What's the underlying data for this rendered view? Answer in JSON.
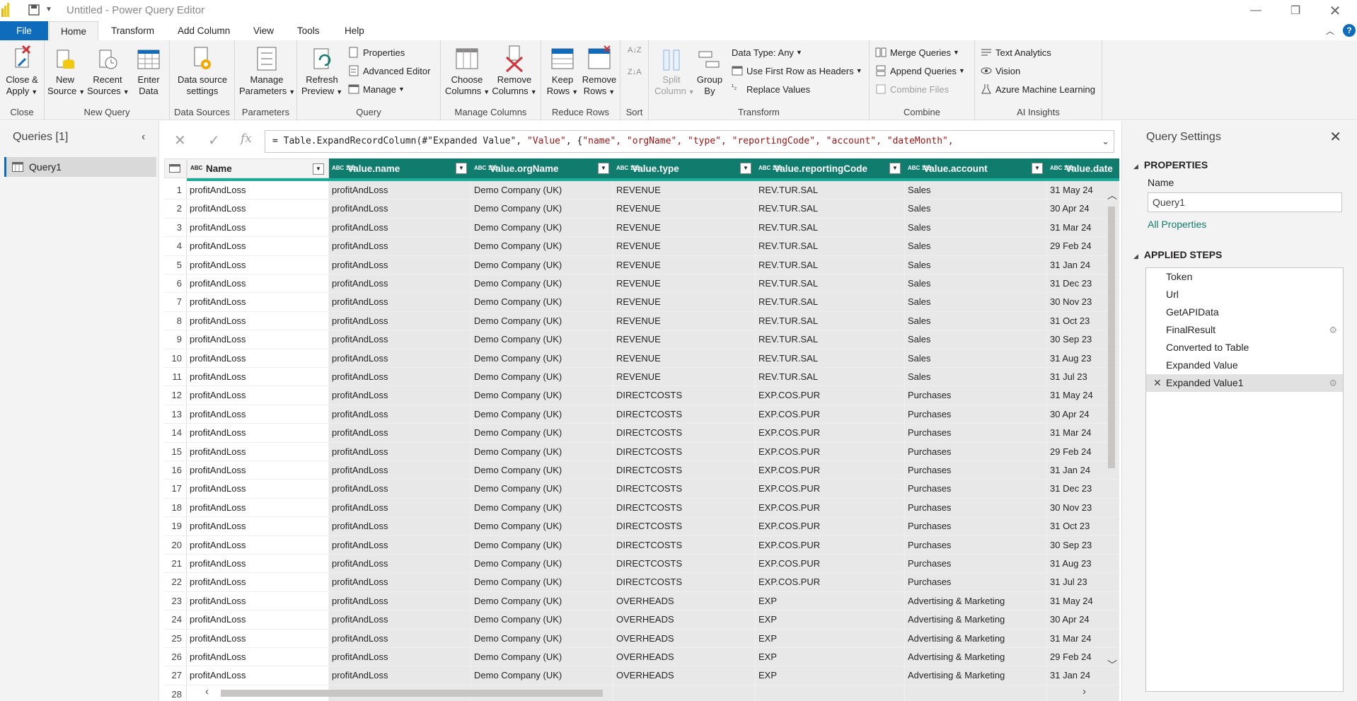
{
  "window": {
    "title": "Untitled - Power Query Editor"
  },
  "tabs": [
    "File",
    "Home",
    "Transform",
    "Add Column",
    "View",
    "Tools",
    "Help"
  ],
  "ribbon": {
    "close": {
      "label1": "Close &",
      "label2": "Apply",
      "group": "Close"
    },
    "new_query": {
      "new_source1": "New",
      "new_source2": "Source",
      "recent1": "Recent",
      "recent2": "Sources",
      "enter1": "Enter",
      "enter2": "Data",
      "group": "New Query"
    },
    "data_sources": {
      "label1": "Data source",
      "label2": "settings",
      "group": "Data Sources"
    },
    "parameters": {
      "label1": "Manage",
      "label2": "Parameters",
      "group": "Parameters"
    },
    "query": {
      "refresh1": "Refresh",
      "refresh2": "Preview",
      "properties": "Properties",
      "advanced": "Advanced Editor",
      "manage": "Manage",
      "group": "Query"
    },
    "manage_columns": {
      "choose1": "Choose",
      "choose2": "Columns",
      "remove1": "Remove",
      "remove2": "Columns",
      "group": "Manage Columns"
    },
    "reduce_rows": {
      "keep1": "Keep",
      "keep2": "Rows",
      "remove1": "Remove",
      "remove2": "Rows",
      "group": "Reduce Rows"
    },
    "sort": {
      "group": "Sort"
    },
    "transform": {
      "split1": "Split",
      "split2": "Column",
      "group1": "Group",
      "group2": "By",
      "datatype": "Data Type: Any",
      "first_row": "Use First Row as Headers",
      "replace": "Replace Values",
      "group": "Transform"
    },
    "combine": {
      "merge": "Merge Queries",
      "append": "Append Queries",
      "files": "Combine Files",
      "group": "Combine"
    },
    "ai": {
      "text": "Text Analytics",
      "vision": "Vision",
      "azure": "Azure Machine Learning",
      "group": "AI Insights"
    }
  },
  "queries_pane": {
    "title": "Queries [1]",
    "items": [
      "Query1"
    ]
  },
  "formula": {
    "prefix": "= Table.ExpandRecordColumn(#\"Expanded Value\", ",
    "value": "\"Value\"",
    "mid": ", {",
    "fields": "\"name\", \"orgName\", \"type\", \"reportingCode\", \"account\", \"dateMonth\","
  },
  "grid": {
    "columns": [
      {
        "label": "Name",
        "type": "ABC"
      },
      {
        "label": "Value.name",
        "type": "ABC/123"
      },
      {
        "label": "Value.orgName",
        "type": "ABC/123"
      },
      {
        "label": "Value.type",
        "type": "ABC/123"
      },
      {
        "label": "Value.reportingCode",
        "type": "ABC/123"
      },
      {
        "label": "Value.account",
        "type": "ABC/123"
      },
      {
        "label": "Value.date",
        "type": "ABC/123"
      }
    ],
    "rows": [
      [
        "1",
        "profitAndLoss",
        "profitAndLoss",
        "Demo Company (UK)",
        "REVENUE",
        "REV.TUR.SAL",
        "Sales",
        "31 May 24"
      ],
      [
        "2",
        "profitAndLoss",
        "profitAndLoss",
        "Demo Company (UK)",
        "REVENUE",
        "REV.TUR.SAL",
        "Sales",
        "30 Apr 24"
      ],
      [
        "3",
        "profitAndLoss",
        "profitAndLoss",
        "Demo Company (UK)",
        "REVENUE",
        "REV.TUR.SAL",
        "Sales",
        "31 Mar 24"
      ],
      [
        "4",
        "profitAndLoss",
        "profitAndLoss",
        "Demo Company (UK)",
        "REVENUE",
        "REV.TUR.SAL",
        "Sales",
        "29 Feb 24"
      ],
      [
        "5",
        "profitAndLoss",
        "profitAndLoss",
        "Demo Company (UK)",
        "REVENUE",
        "REV.TUR.SAL",
        "Sales",
        "31 Jan 24"
      ],
      [
        "6",
        "profitAndLoss",
        "profitAndLoss",
        "Demo Company (UK)",
        "REVENUE",
        "REV.TUR.SAL",
        "Sales",
        "31 Dec 23"
      ],
      [
        "7",
        "profitAndLoss",
        "profitAndLoss",
        "Demo Company (UK)",
        "REVENUE",
        "REV.TUR.SAL",
        "Sales",
        "30 Nov 23"
      ],
      [
        "8",
        "profitAndLoss",
        "profitAndLoss",
        "Demo Company (UK)",
        "REVENUE",
        "REV.TUR.SAL",
        "Sales",
        "31 Oct 23"
      ],
      [
        "9",
        "profitAndLoss",
        "profitAndLoss",
        "Demo Company (UK)",
        "REVENUE",
        "REV.TUR.SAL",
        "Sales",
        "30 Sep 23"
      ],
      [
        "10",
        "profitAndLoss",
        "profitAndLoss",
        "Demo Company (UK)",
        "REVENUE",
        "REV.TUR.SAL",
        "Sales",
        "31 Aug 23"
      ],
      [
        "11",
        "profitAndLoss",
        "profitAndLoss",
        "Demo Company (UK)",
        "REVENUE",
        "REV.TUR.SAL",
        "Sales",
        "31 Jul 23"
      ],
      [
        "12",
        "profitAndLoss",
        "profitAndLoss",
        "Demo Company (UK)",
        "DIRECTCOSTS",
        "EXP.COS.PUR",
        "Purchases",
        "31 May 24"
      ],
      [
        "13",
        "profitAndLoss",
        "profitAndLoss",
        "Demo Company (UK)",
        "DIRECTCOSTS",
        "EXP.COS.PUR",
        "Purchases",
        "30 Apr 24"
      ],
      [
        "14",
        "profitAndLoss",
        "profitAndLoss",
        "Demo Company (UK)",
        "DIRECTCOSTS",
        "EXP.COS.PUR",
        "Purchases",
        "31 Mar 24"
      ],
      [
        "15",
        "profitAndLoss",
        "profitAndLoss",
        "Demo Company (UK)",
        "DIRECTCOSTS",
        "EXP.COS.PUR",
        "Purchases",
        "29 Feb 24"
      ],
      [
        "16",
        "profitAndLoss",
        "profitAndLoss",
        "Demo Company (UK)",
        "DIRECTCOSTS",
        "EXP.COS.PUR",
        "Purchases",
        "31 Jan 24"
      ],
      [
        "17",
        "profitAndLoss",
        "profitAndLoss",
        "Demo Company (UK)",
        "DIRECTCOSTS",
        "EXP.COS.PUR",
        "Purchases",
        "31 Dec 23"
      ],
      [
        "18",
        "profitAndLoss",
        "profitAndLoss",
        "Demo Company (UK)",
        "DIRECTCOSTS",
        "EXP.COS.PUR",
        "Purchases",
        "30 Nov 23"
      ],
      [
        "19",
        "profitAndLoss",
        "profitAndLoss",
        "Demo Company (UK)",
        "DIRECTCOSTS",
        "EXP.COS.PUR",
        "Purchases",
        "31 Oct 23"
      ],
      [
        "20",
        "profitAndLoss",
        "profitAndLoss",
        "Demo Company (UK)",
        "DIRECTCOSTS",
        "EXP.COS.PUR",
        "Purchases",
        "30 Sep 23"
      ],
      [
        "21",
        "profitAndLoss",
        "profitAndLoss",
        "Demo Company (UK)",
        "DIRECTCOSTS",
        "EXP.COS.PUR",
        "Purchases",
        "31 Aug 23"
      ],
      [
        "22",
        "profitAndLoss",
        "profitAndLoss",
        "Demo Company (UK)",
        "DIRECTCOSTS",
        "EXP.COS.PUR",
        "Purchases",
        "31 Jul 23"
      ],
      [
        "23",
        "profitAndLoss",
        "profitAndLoss",
        "Demo Company (UK)",
        "OVERHEADS",
        "EXP",
        "Advertising & Marketing",
        "31 May 24"
      ],
      [
        "24",
        "profitAndLoss",
        "profitAndLoss",
        "Demo Company (UK)",
        "OVERHEADS",
        "EXP",
        "Advertising & Marketing",
        "30 Apr 24"
      ],
      [
        "25",
        "profitAndLoss",
        "profitAndLoss",
        "Demo Company (UK)",
        "OVERHEADS",
        "EXP",
        "Advertising & Marketing",
        "31 Mar 24"
      ],
      [
        "26",
        "profitAndLoss",
        "profitAndLoss",
        "Demo Company (UK)",
        "OVERHEADS",
        "EXP",
        "Advertising & Marketing",
        "29 Feb 24"
      ],
      [
        "27",
        "profitAndLoss",
        "profitAndLoss",
        "Demo Company (UK)",
        "OVERHEADS",
        "EXP",
        "Advertising & Marketing",
        "31 Jan 24"
      ],
      [
        "28",
        "",
        "",
        "",
        "",
        "",
        "",
        ""
      ]
    ]
  },
  "settings": {
    "title": "Query Settings",
    "properties_header": "PROPERTIES",
    "name_label": "Name",
    "name_value": "Query1",
    "all_properties": "All Properties",
    "steps_header": "APPLIED STEPS",
    "steps": [
      "Token",
      "Url",
      "GetAPIData",
      "FinalResult",
      "Converted to Table",
      "Expanded Value",
      "Expanded Value1"
    ]
  },
  "colors": {
    "accent": "#0f6cbd",
    "header_teal": "#107c6e",
    "brand_yellow": "#f2c811"
  }
}
